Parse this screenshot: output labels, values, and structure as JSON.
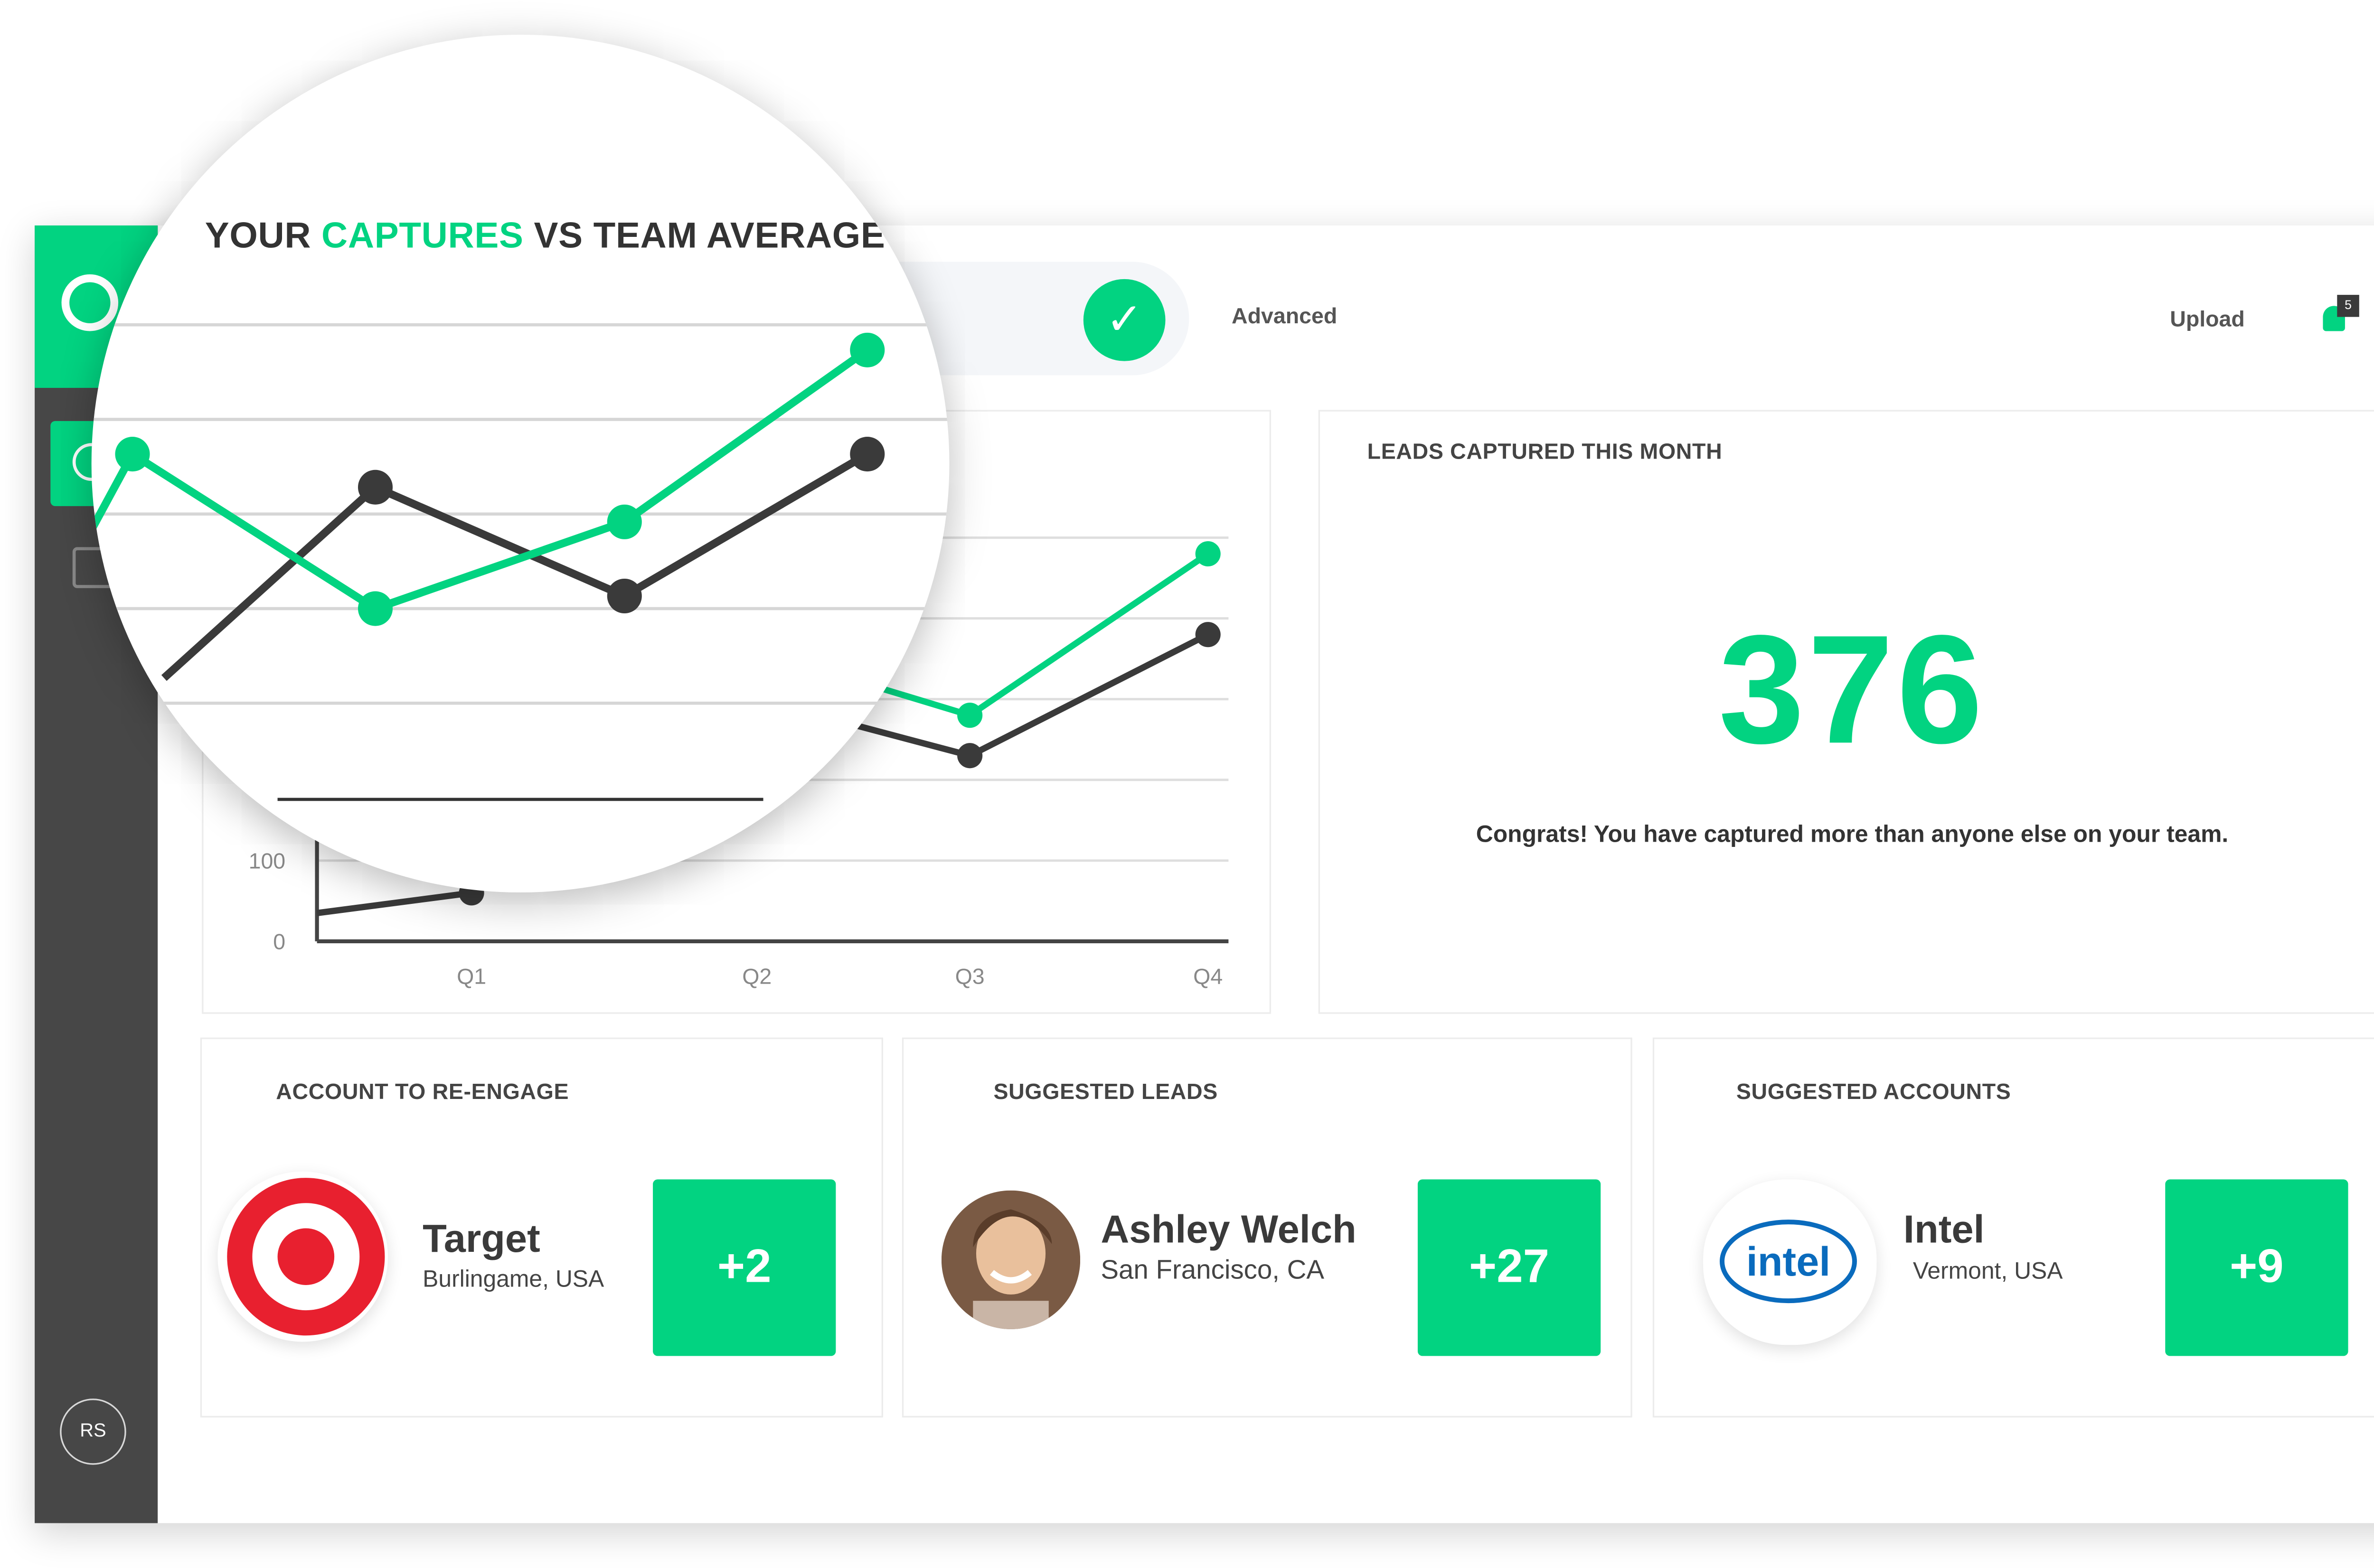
{
  "user": {
    "initials": "RS"
  },
  "topbar": {
    "advanced_label": "Advanced",
    "upload_label": "Upload",
    "notification_count": "5"
  },
  "captures_chart": {
    "title_pre": "YOUR ",
    "title_accent": "CAPTURES",
    "title_post": " VS TEAM AVERAGE"
  },
  "chart_data": {
    "type": "line",
    "categories": [
      "Q1",
      "Q2",
      "Q3",
      "Q4"
    ],
    "yticks": [
      0,
      100
    ],
    "ylim": [
      0,
      500
    ],
    "series": [
      {
        "color": "#02d381",
        "values": [
          260,
          360,
          280,
          480
        ]
      },
      {
        "color": "#3a3a3a",
        "values": [
          60,
          300,
          230,
          380
        ]
      }
    ],
    "legend": "none"
  },
  "leads_month": {
    "title": "LEADS CAPTURED THIS MONTH",
    "value": "376",
    "message": "Congrats! You have captured more than anyone else on your team."
  },
  "reengage": {
    "title": "ACCOUNT TO RE-ENGAGE",
    "name": "Target",
    "location": "Burlingame, USA",
    "score": "+2"
  },
  "suggested_leads": {
    "title": "SUGGESTED LEADS",
    "name": "Ashley Welch",
    "location": "San Francisco, CA",
    "score": "+27"
  },
  "suggested_accounts": {
    "title": "SUGGESTED ACCOUNTS",
    "name": "Intel",
    "location": "Vermont, USA",
    "score": "+9",
    "logo_text": "intel"
  },
  "colors": {
    "accent": "#02d381",
    "sidebar": "#474747",
    "team_line": "#3a3a3a"
  }
}
